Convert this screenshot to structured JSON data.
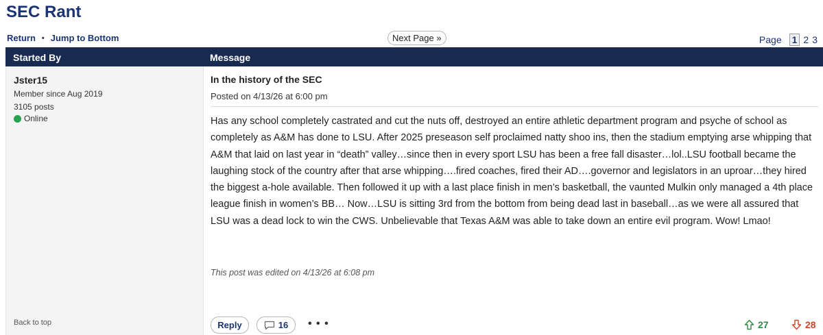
{
  "board": {
    "title": "SEC Rant"
  },
  "nav": {
    "return_label": "Return",
    "separator": "•",
    "jump_label": "Jump to Bottom"
  },
  "pagination": {
    "next_label": "Next Page »",
    "page_label": "Page",
    "pages": [
      "1",
      "2",
      "3"
    ],
    "current_page": "1"
  },
  "table_header": {
    "started_by": "Started By",
    "message": "Message"
  },
  "author": {
    "name": "Jster15",
    "member_since": "Member since Aug 2019",
    "posts": "3105 posts",
    "status": "Online",
    "status_color": "#2aa14e"
  },
  "post": {
    "title": "In the history of the SEC",
    "posted": "Posted on 4/13/26 at 6:00 pm",
    "body": "Has any school completely castrated and cut the nuts off, destroyed an entire athletic department program and psyche of school as completely as A&M has done to LSU. After 2025 preseason self proclaimed natty shoo ins, then the stadium emptying arse whipping that A&M that laid on last year in “death” valley…since then in every sport LSU has been a free fall disaster…lol..LSU football became the laughing stock of the country after that arse whipping….fired coaches, fired their AD….governor and legislators in an uproar…they hired the biggest a-hole available. Then followed it up with a last place finish in men’s basketball, the vaunted Mulkin only managed a 4th place league finish in women’s BB… Now…LSU is sitting 3rd from the bottom from being dead last in baseball…as we were all assured that LSU was a dead lock to win the CWS. Unbelievable that Texas A&M was able to take down an entire evil program. Wow! Lmao!",
    "edited": "This post was edited on 4/13/26 at 6:08 pm"
  },
  "actions": {
    "back_to_top": "Back to top",
    "reply_label": "Reply",
    "comment_count": "16",
    "more_label": "• • •",
    "upvotes": "27",
    "downvotes": "28",
    "upvote_color": "#2b8a3e",
    "downvote_color": "#d9411e"
  },
  "icons": [
    "comment-bubble-icon",
    "up-arrow-icon",
    "down-arrow-icon",
    "online-status-dot"
  ]
}
